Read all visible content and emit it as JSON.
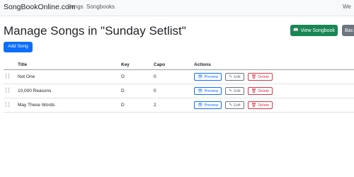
{
  "navbar": {
    "brand": "SongBookOnline.com",
    "links": [
      "Songs",
      "Songbooks"
    ],
    "welcome": "We"
  },
  "page": {
    "title": "Manage Songs in \"Sunday Setlist\"",
    "view_songbook_label": "View Songbook",
    "back_label": "Bac",
    "add_song_label": "Add Song"
  },
  "table": {
    "headers": {
      "title": "Title",
      "key": "Key",
      "capo": "Capo",
      "actions": "Actions"
    },
    "action_labels": {
      "preview": "Preview",
      "edit": "Edit",
      "delete": "Delete"
    },
    "rows": [
      {
        "title": "Not One",
        "key": "G",
        "capo": "0"
      },
      {
        "title": "10,000 Reasons",
        "key": "D",
        "capo": "0"
      },
      {
        "title": "May These Words",
        "key": "D",
        "capo": "2"
      }
    ]
  },
  "colors": {
    "primary": "#0d6efd",
    "success": "#198754",
    "secondary": "#6c757d",
    "danger": "#dc3545"
  },
  "icons": {
    "view_songbook": "book-icon",
    "preview": "eye-icon",
    "edit": "pencil-icon",
    "delete": "trash-icon",
    "drag": "drag-handle-icon"
  }
}
